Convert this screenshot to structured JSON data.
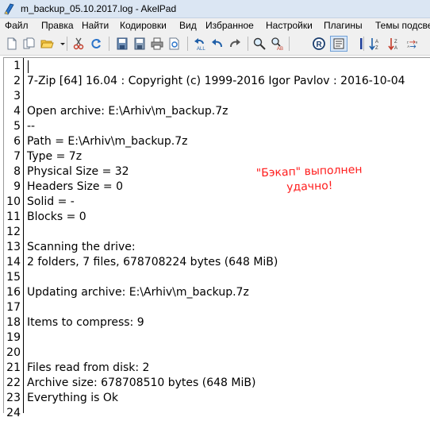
{
  "window": {
    "title": "m_backup_05.10.2017.log - AkelPad"
  },
  "menu": [
    "Файл",
    "Правка",
    "Найти",
    "Кодировки",
    "Вид",
    "Избранное",
    "Настройки",
    "Плагины",
    "Темы подсвет"
  ],
  "toolbar": {
    "buttons": [
      "new-file-icon",
      "copy-file-icon",
      "open-folder-icon",
      "dropdown-arrow-icon",
      "cut-icon",
      "reload-icon",
      "save-icon",
      "save-as-icon",
      "print-icon",
      "print-preview-icon",
      "undo-all-icon",
      "undo-icon",
      "redo-icon",
      "find-icon",
      "replace-icon",
      "registered-icon",
      "text-view-icon",
      "column-marker-icon",
      "sort-az-icon",
      "sort-za-icon",
      "convert-icon"
    ]
  },
  "editor": {
    "lines": [
      "",
      "7-Zip [64] 16.04 : Copyright (c) 1999-2016 Igor Pavlov : 2016-10-04",
      "",
      "Open archive: E:\\Arhiv\\m_backup.7z",
      "--",
      "Path = E:\\Arhiv\\m_backup.7z",
      "Type = 7z",
      "Physical Size = 32",
      "Headers Size = 0",
      "Solid = -",
      "Blocks = 0",
      "",
      "Scanning the drive:",
      "2 folders, 7 files, 678708224 bytes (648 MiB)",
      "",
      "Updating archive: E:\\Arhiv\\m_backup.7z",
      "",
      "Items to compress: 9",
      "",
      "",
      "Files read from disk: 2",
      "Archive size: 678708510 bytes (648 MiB)",
      "Everything is Ok",
      ""
    ],
    "line_numbers": [
      "1",
      "2",
      "3",
      "4",
      "5",
      "6",
      "7",
      "8",
      "9",
      "10",
      "11",
      "12",
      "13",
      "14",
      "15",
      "16",
      "17",
      "18",
      "19",
      "20",
      "21",
      "22",
      "23",
      "24"
    ]
  },
  "annotation": {
    "line1": "\"Бэкап\" выполнен",
    "line2": "удачно!",
    "color": "#ff1c1c"
  }
}
